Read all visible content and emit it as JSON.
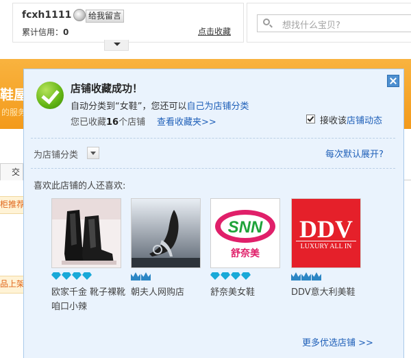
{
  "seller": {
    "name": "fcxh1111",
    "leave_message": "给我留言",
    "credit_label": "累计信用：",
    "credit_value": "0",
    "favorite_link": "点击收藏"
  },
  "search": {
    "placeholder": "想找什么宝贝?"
  },
  "background": {
    "banner_title": "鞋屋",
    "banner_sub": "的服务",
    "tab_label": "交",
    "band1_text": "柜推荐",
    "band2_text": "品上架"
  },
  "popup": {
    "title": "店铺收藏成功！",
    "auto_category_prefix": "自动分类到“女鞋”，您还可以",
    "auto_category_link": "自己为店铺分类",
    "collected_prefix": "您已收藏",
    "collected_count": "16",
    "collected_suffix": "个店铺",
    "view_favorites": "查看收藏夹>>",
    "receive_prefix": "接收该",
    "receive_link": "店铺动态",
    "receive_checked": true,
    "category_label": "为店铺分类",
    "default_expand": "每次默认展开?",
    "also_like": "喜欢此店铺的人还喜欢:",
    "more_shops": "更多优选店铺 >>",
    "shops": [
      {
        "name": "欧家千金 靴子裸靴 咱口小辣",
        "rating_icon": "diamond-icon",
        "rating_count": 4
      },
      {
        "name": "朝夫人网购店",
        "rating_icon": "crown-icon",
        "rating_count": 2
      },
      {
        "name": "舒奈美女鞋",
        "rating_icon": "diamond-icon",
        "rating_count": 4,
        "logo_text": "SNN",
        "logo_sub": "舒奈美"
      },
      {
        "name": "DDV意大利美鞋",
        "rating_icon": "crown-icon",
        "rating_count": 3,
        "logo_text": "DDV",
        "logo_sub": "LUXURY ALL IN"
      }
    ]
  },
  "colors": {
    "banner": "#f5a623",
    "popup_bg": "#eaf3fd",
    "link": "#1e5fb8",
    "success": "#62b414",
    "ddv_red": "#e5202a"
  }
}
